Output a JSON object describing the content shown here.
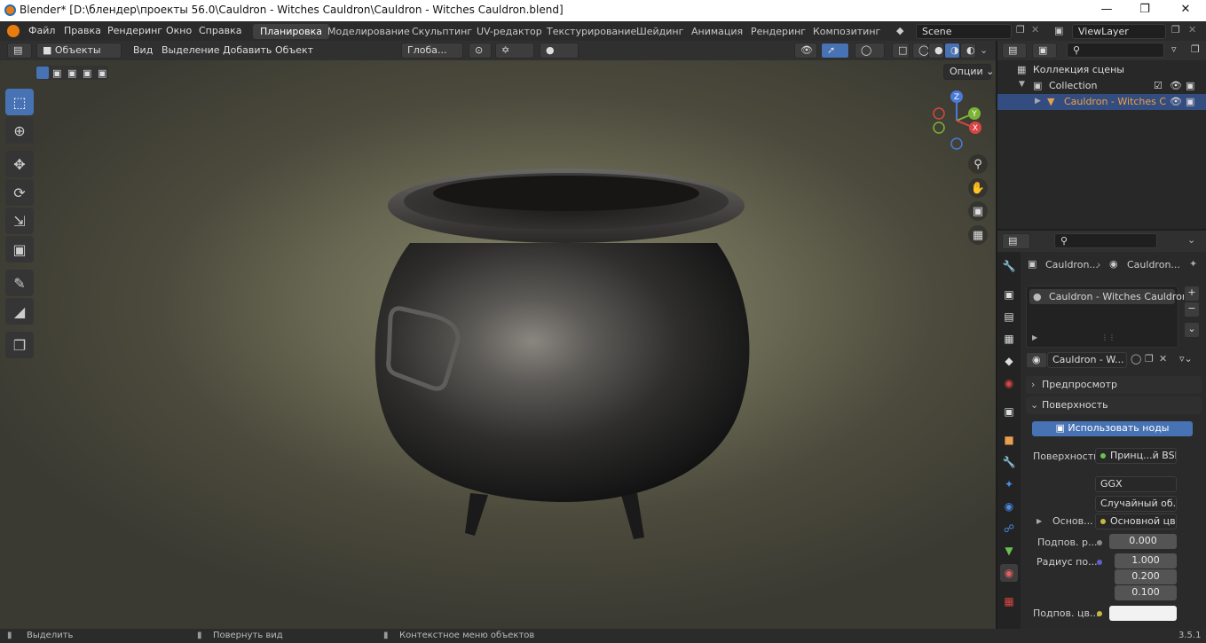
{
  "window": {
    "title": "Blender* [D:\\блендер\\проекты 56.0\\Cauldron - Witches Cauldron\\Cauldron - Witches Cauldron.blend]",
    "minimize_icon": "minimize-icon",
    "maximize_icon": "maximize-icon",
    "close_icon": "close-icon"
  },
  "menu": {
    "items": [
      "Файл",
      "Правка",
      "Рендеринг",
      "Окно",
      "Справка"
    ],
    "workspaces": [
      "Планировка",
      "Моделирование",
      "Скульптинг",
      "UV-редактор",
      "Текстурирование",
      "Шейдинг",
      "Анимация",
      "Рендеринг",
      "Композитинг"
    ],
    "active_workspace": "Планировка",
    "scene": "Scene",
    "view_layer": "ViewLayer"
  },
  "viewport": {
    "mode": "Объекты",
    "menus": [
      "Вид",
      "Выделение",
      "Добавить",
      "Объект"
    ],
    "orientation": "Глоба...",
    "options_label": "Опции",
    "gizmo_axes": [
      "X",
      "Y",
      "Z"
    ],
    "tools": [
      "select-box-icon",
      "cursor-icon",
      "move-icon",
      "rotate-icon",
      "scale-icon",
      "transform-icon",
      "annotate-icon",
      "measure-icon",
      "add-cube-icon"
    ]
  },
  "outliner": {
    "scene_collection": "Коллекция сцены",
    "collection": "Collection",
    "object": "Cauldron - Witches C"
  },
  "properties": {
    "breadcrumb_object": "Cauldron...",
    "breadcrumb_material": "Cauldron...",
    "material_slot": "Cauldron - Witches Cauldron",
    "material_name": "Cauldron - W...",
    "preview_panel": "Предпросмотр",
    "surface_panel": "Поверхность",
    "use_nodes_button": "Использовать ноды",
    "surface_label": "Поверхность",
    "surface_value": "Принц...й BSDF",
    "distribution": "GGX",
    "subsurface_method": "Случайный об...",
    "base_label": "Основ...",
    "base_value": "Основной цвет",
    "subsurface_label": "Подпов. р...",
    "subsurface_value": "0.000",
    "radius_label": "Радиус по...",
    "radius_values": [
      "1.000",
      "0.200",
      "0.100"
    ],
    "subsurface_color_label": "Подпов. цв..."
  },
  "status": {
    "select": "Выделить",
    "rotate_view": "Повернуть вид",
    "context_menu": "Контекстное меню объектов",
    "version": "3.5.1"
  },
  "colors": {
    "accent": "#4772b3",
    "selected_object": "#f0a040"
  }
}
